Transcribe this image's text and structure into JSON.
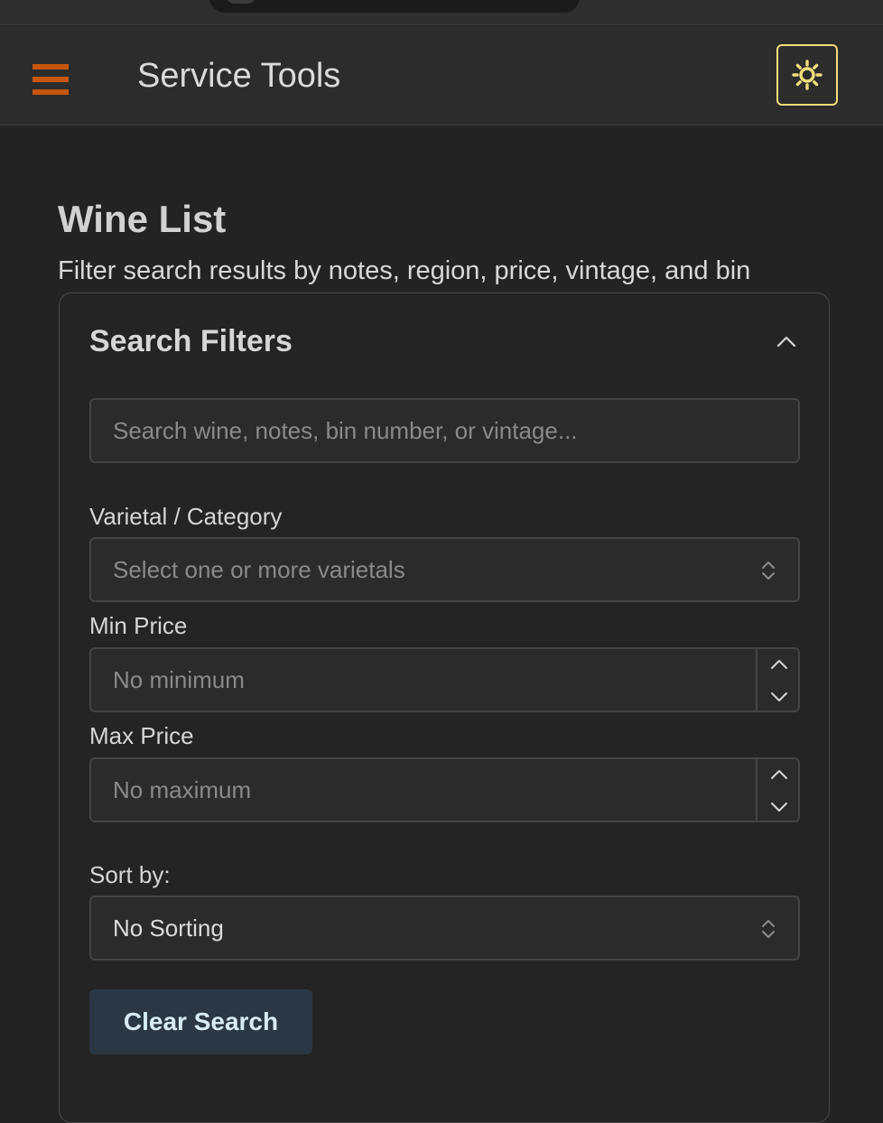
{
  "header": {
    "title": "Service Tools",
    "accent_color": "#c6560d",
    "theme_toggle_color": "#f2dd7c"
  },
  "page": {
    "title": "Wine List",
    "subtitle": "Filter search results by notes, region, price, vintage, and bin"
  },
  "filters": {
    "title": "Search Filters",
    "search_placeholder": "Search wine, notes, bin number, or vintage...",
    "varietal_label": "Varietal / Category",
    "varietal_placeholder": "Select one or more varietals",
    "min_price_label": "Min Price",
    "min_price_placeholder": "No minimum",
    "max_price_label": "Max Price",
    "max_price_placeholder": "No maximum",
    "sort_label": "Sort by:",
    "sort_value": "No Sorting",
    "clear_label": "Clear Search",
    "clear_button_color": "#2a3845"
  }
}
